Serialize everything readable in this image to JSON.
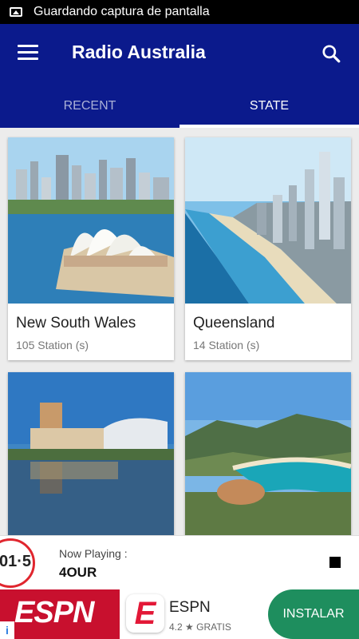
{
  "status_bar": {
    "text": "Guardando captura de pantalla",
    "icon": "screenshot-icon"
  },
  "app_bar": {
    "title": "Radio Australia",
    "menu_icon": "menu-icon",
    "search_icon": "search-icon",
    "color": "#0b1a8c"
  },
  "tabs": [
    {
      "label": "RECENT",
      "active": false
    },
    {
      "label": "STATE",
      "active": true
    }
  ],
  "states": [
    {
      "name": "New South Wales",
      "count": "105 Station (s)",
      "image": "sydney-opera-house-photo"
    },
    {
      "name": "Queensland",
      "count": "14 Station (s)",
      "image": "gold-coast-beach-photo"
    },
    {
      "name": "",
      "count": "",
      "image": "adelaide-river-city-photo"
    },
    {
      "name": "",
      "count": "",
      "image": "tasmania-bay-photo"
    }
  ],
  "player": {
    "label": "Now Playing :",
    "station": "4OUR",
    "logo_text": "01·5",
    "stop_icon": "stop-icon"
  },
  "ad": {
    "banner_text": "ESPN",
    "app_name": "ESPN",
    "rating": "4.2 ★ GRATIS",
    "install_label": "INSTALAR",
    "icon_letter": "E",
    "info_icon": "i"
  }
}
